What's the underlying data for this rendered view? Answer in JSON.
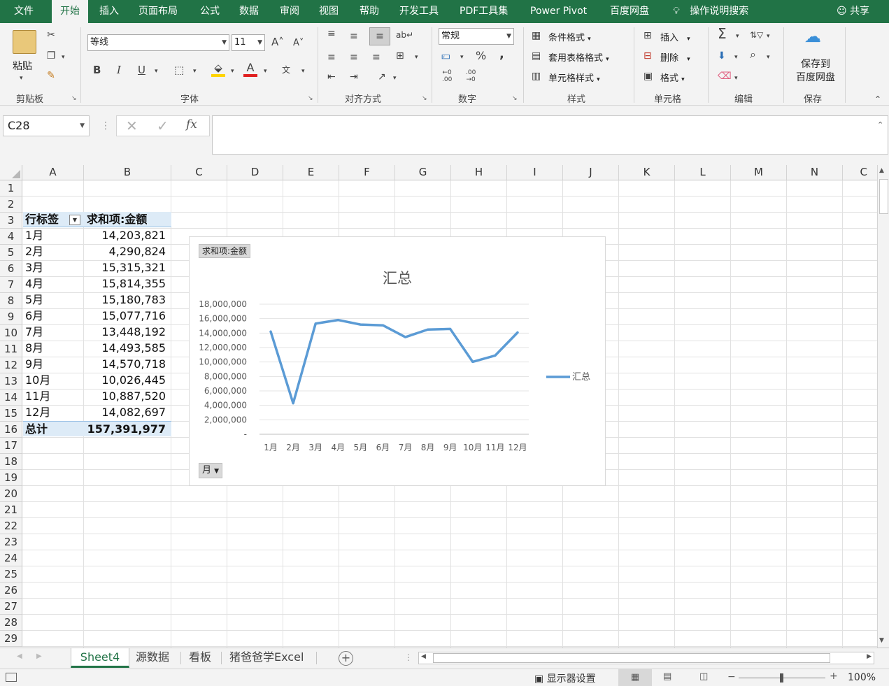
{
  "ribbon_tabs": [
    "文件",
    "开始",
    "插入",
    "页面布局",
    "公式",
    "数据",
    "审阅",
    "视图",
    "帮助",
    "开发工具",
    "PDF工具集",
    "Power Pivot",
    "百度网盘"
  ],
  "tell_me": "操作说明搜索",
  "share": "共享",
  "groups": {
    "clipboard": {
      "label": "剪贴板",
      "paste": "粘贴"
    },
    "font": {
      "label": "字体",
      "name": "等线",
      "size": "11",
      "bold": "B",
      "italic": "I",
      "underline": "U"
    },
    "alignment": {
      "label": "对齐方式"
    },
    "number": {
      "label": "数字",
      "format": "常规"
    },
    "styles": {
      "label": "样式",
      "conditional": "条件格式",
      "table": "套用表格格式",
      "cell": "单元格样式"
    },
    "cells": {
      "label": "单元格",
      "insert": "插入",
      "delete": "删除",
      "format": "格式"
    },
    "editing": {
      "label": "编辑"
    },
    "save": {
      "label": "保存",
      "button": "保存到\n百度网盘"
    }
  },
  "name_box": "C28",
  "fx": "fx",
  "columns": [
    "A",
    "B",
    "C",
    "D",
    "E",
    "F",
    "G",
    "H",
    "I",
    "J",
    "K",
    "L",
    "M",
    "N",
    "C"
  ],
  "rows": [
    "1",
    "2",
    "3",
    "4",
    "5",
    "6",
    "7",
    "8",
    "9",
    "10",
    "11",
    "12",
    "13",
    "14",
    "15",
    "16",
    "17",
    "18",
    "19",
    "20",
    "21",
    "22",
    "23",
    "24",
    "25",
    "26",
    "27",
    "28",
    "29"
  ],
  "pivot": {
    "header_label": "行标签",
    "header_value": "求和项:金额",
    "rows": [
      {
        "label": "1月",
        "value": "14,203,821"
      },
      {
        "label": "2月",
        "value": "4,290,824"
      },
      {
        "label": "3月",
        "value": "15,315,321"
      },
      {
        "label": "4月",
        "value": "15,814,355"
      },
      {
        "label": "5月",
        "value": "15,180,783"
      },
      {
        "label": "6月",
        "value": "15,077,716"
      },
      {
        "label": "7月",
        "value": "13,448,192"
      },
      {
        "label": "8月",
        "value": "14,493,585"
      },
      {
        "label": "9月",
        "value": "14,570,718"
      },
      {
        "label": "10月",
        "value": "10,026,445"
      },
      {
        "label": "11月",
        "value": "10,887,520"
      },
      {
        "label": "12月",
        "value": "14,082,697"
      }
    ],
    "total_label": "总计",
    "total_value": "157,391,977"
  },
  "chart_data": {
    "type": "line",
    "title": "汇总",
    "field_button": "求和项:金额",
    "axis_field_button": "月",
    "categories": [
      "1月",
      "2月",
      "3月",
      "4月",
      "5月",
      "6月",
      "7月",
      "8月",
      "9月",
      "10月",
      "11月",
      "12月"
    ],
    "series": [
      {
        "name": "汇总",
        "values": [
          14203821,
          4290824,
          15315321,
          15814355,
          15180783,
          15077716,
          13448192,
          14493585,
          14570718,
          10026445,
          10887520,
          14082697
        ],
        "color": "#5B9BD5"
      }
    ],
    "ylim": [
      0,
      18000000
    ],
    "yticks": [
      0,
      2000000,
      4000000,
      6000000,
      8000000,
      10000000,
      12000000,
      14000000,
      16000000,
      18000000
    ],
    "ytick_labels": [
      "-",
      "2,000,000",
      "4,000,000",
      "6,000,000",
      "8,000,000",
      "10,000,000",
      "12,000,000",
      "14,000,000",
      "16,000,000",
      "18,000,000"
    ],
    "grid": true,
    "legend": "right"
  },
  "sheets": [
    "Sheet4",
    "源数据",
    "看板",
    "猪爸爸学Excel"
  ],
  "status": {
    "display_settings": "显示器设置",
    "zoom": "100%"
  },
  "colors": {
    "excel_green": "#217346",
    "pivot_header_bg": "#DDEBF7",
    "series": "#5B9BD5"
  }
}
